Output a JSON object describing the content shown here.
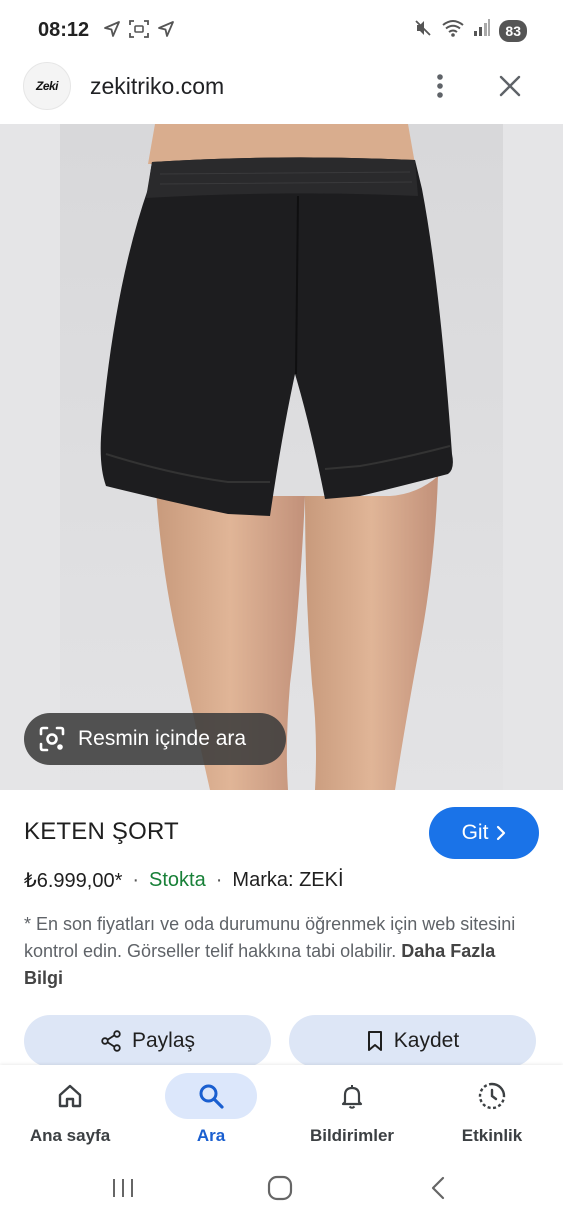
{
  "status_bar": {
    "time": "08:12",
    "battery": "83",
    "icons": [
      "navigation-icon",
      "screenshot-icon",
      "navigation-icon",
      "mute-icon",
      "wifi-icon",
      "signal-icon"
    ]
  },
  "header": {
    "logo_text": "Zeki",
    "domain": "zekitriko.com"
  },
  "image": {
    "lens_label": "Resmin içinde ara"
  },
  "product": {
    "title": "KETEN ŞORT",
    "go_label": "Git",
    "price": "₺6.999,00*",
    "stock": "Stokta",
    "brand": "Marka: ZEKİ",
    "disclaimer": "* En son fiyatları ve oda durumunu öğrenmek için web sitesini kontrol edin. Görseller telif hakkına tabi olabilir.",
    "more_info": "Daha Fazla Bilgi",
    "share_label": "Paylaş",
    "save_label": "Kaydet"
  },
  "bottom_nav": {
    "items": [
      {
        "label": "Ana sayfa",
        "icon": "home-icon"
      },
      {
        "label": "Ara",
        "icon": "search-icon",
        "active": true
      },
      {
        "label": "Bildirimler",
        "icon": "bell-icon"
      },
      {
        "label": "Etkinlik",
        "icon": "activity-icon"
      }
    ]
  },
  "colors": {
    "accent": "#1a73e8",
    "stock": "#188038",
    "chip_bg": "#dde6f6"
  }
}
